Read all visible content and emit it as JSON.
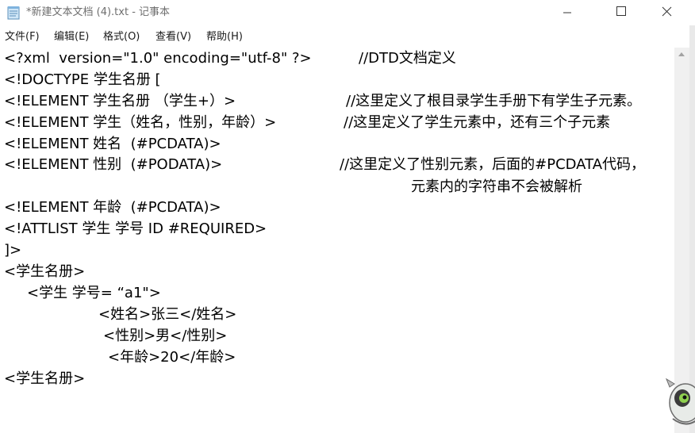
{
  "window": {
    "title": "*新建文本文档 (4).txt - 记事本"
  },
  "menu": {
    "items": [
      "文件(F)",
      "编辑(E)",
      "格式(O)",
      "查看(V)",
      "帮助(H)"
    ]
  },
  "editor": {
    "lines": [
      "<?xml  version=\"1.0\" encoding=\"utf-8\" ?>",
      "//DTD文档定义",
      "<!DOCTYPE 学生名册 [",
      "<!ELEMENT 学生名册 （学生+）>",
      "//这里定义了根目录学生手册下有学生子元素。",
      "<!ELEMENT 学生（姓名，性别，年龄）>",
      "//这里定义了学生元素中，还有三个子元素",
      "<!ELEMENT 姓名  (#PCDATA)>",
      "<!ELEMENT 性别  (#PODATA)>",
      "//这里定义了性别元素，后面的#PCDATA代码，",
      "元素内的字符串不会被解析",
      "<!ELEMENT 年龄  (#PCDATA)>",
      "<!ATTLIST 学生 学号 ID #REQUIRED>",
      "]>",
      "<学生名册>",
      "<学生 学号= “a1\">",
      "<姓名>张三</姓名>",
      "<性别>男</性别>",
      "<年龄>20</年龄>",
      "<学生名册>"
    ]
  },
  "colors": {
    "title_text": "#6e6e6e",
    "editor_text": "#000000",
    "scrollbar": "#f0f0f0"
  },
  "icons": {
    "app": "notepad-icon",
    "minimize": "minimize-icon",
    "maximize": "maximize-icon",
    "close": "close-icon",
    "scroll_up": "scroll-up-arrow-icon",
    "mascot": "mascot-icon"
  }
}
